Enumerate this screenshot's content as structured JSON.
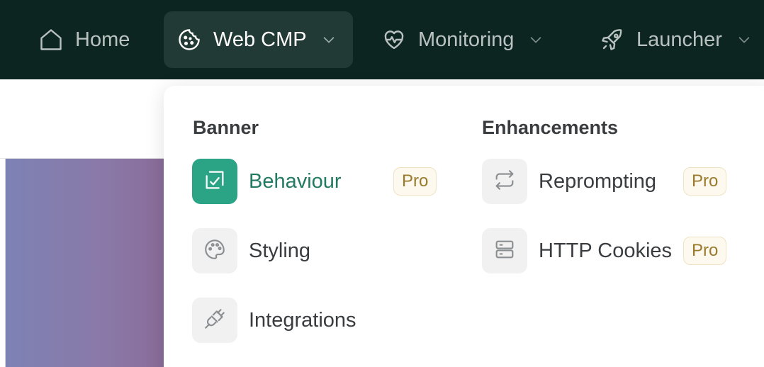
{
  "nav": {
    "items": [
      {
        "label": "Home",
        "icon": "home-icon"
      },
      {
        "label": "Web CMP",
        "icon": "cookie-icon",
        "active": true
      },
      {
        "label": "Monitoring",
        "icon": "heart-pulse-icon"
      },
      {
        "label": "Launcher",
        "icon": "rocket-icon"
      }
    ]
  },
  "dropdown": {
    "banner": {
      "heading": "Banner",
      "items": [
        {
          "label": "Behaviour",
          "icon": "checkbox-square-icon",
          "badge": "Pro",
          "active": true
        },
        {
          "label": "Styling",
          "icon": "palette-icon"
        },
        {
          "label": "Integrations",
          "icon": "plug-icon"
        }
      ]
    },
    "enhancements": {
      "heading": "Enhancements",
      "items": [
        {
          "label": "Reprompting",
          "icon": "repeat-icon",
          "badge": "Pro"
        },
        {
          "label": "HTTP Cookies",
          "icon": "server-icon",
          "badge": "Pro"
        }
      ]
    }
  },
  "colors": {
    "nav_bg": "#0c2520",
    "nav_active_bg": "#223a35",
    "accent": "#2aa484",
    "accent_text": "#237a63",
    "badge_text": "#9a7a2c",
    "badge_bg": "#fdf9ee"
  }
}
